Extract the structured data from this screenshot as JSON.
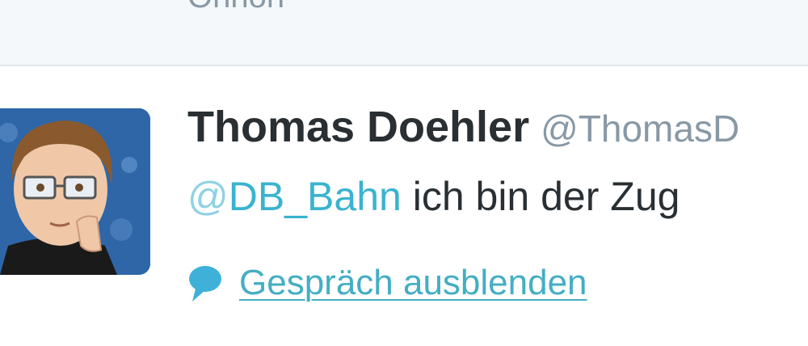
{
  "previous_tweet": {
    "text": "Ohnon"
  },
  "tweet": {
    "fullname": "Thomas Doehler",
    "screen_name": "@ThomasD",
    "mention_at": "@",
    "mention_handle": "DB_Bahn",
    "text": " ich bin der Zug",
    "conversation_link": "Gespräch ausblenden"
  },
  "colors": {
    "link": "#3ab3cf",
    "muted": "#8899a6",
    "text": "#292f33",
    "background_prev": "#f5f8fa"
  },
  "icons": {
    "conversation": "speech-bubble-icon",
    "avatar": "cartoon-avatar"
  }
}
